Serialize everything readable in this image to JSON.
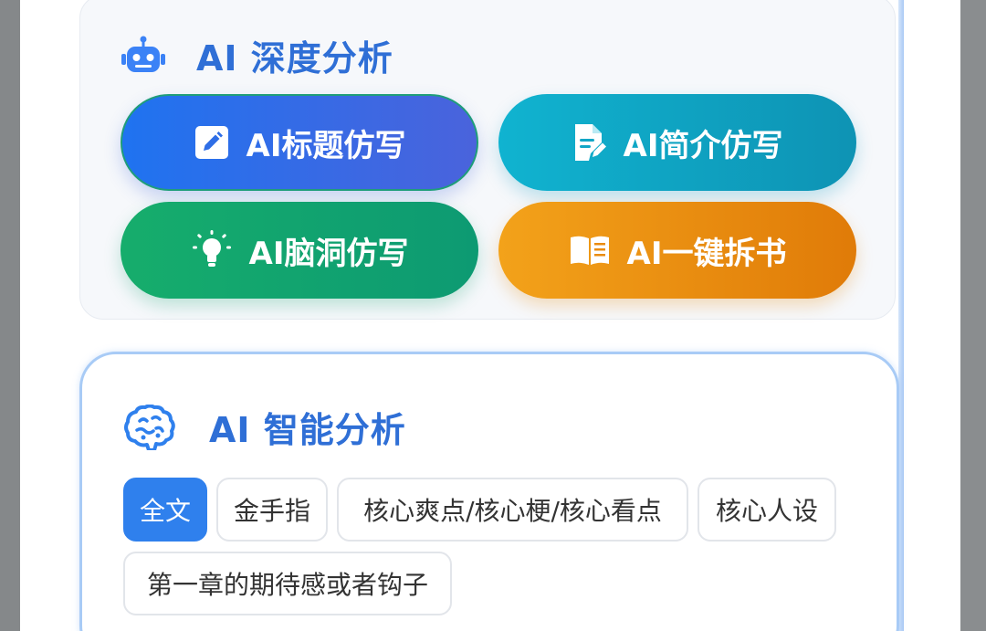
{
  "deep_analysis": {
    "title": "AI 深度分析",
    "icon": "robot-icon",
    "buttons": [
      {
        "label": "AI标题仿写",
        "icon": "edit-icon",
        "color": "#1f73f0"
      },
      {
        "label": "AI简介仿写",
        "icon": "document-edit-icon",
        "color": "#10b3d0"
      },
      {
        "label": "AI脑洞仿写",
        "icon": "lightbulb-icon",
        "color": "#16ad6c"
      },
      {
        "label": "AI一键拆书",
        "icon": "book-open-icon",
        "color": "#f3a21a"
      }
    ]
  },
  "smart_analysis": {
    "title": "AI 智能分析",
    "icon": "brain-icon",
    "tabs": [
      {
        "label": "全文",
        "active": true
      },
      {
        "label": "金手指",
        "active": false
      },
      {
        "label": "核心爽点/核心梗/核心看点",
        "active": false
      },
      {
        "label": "核心人设",
        "active": false
      },
      {
        "label": "第一章的期待感或者钩子",
        "active": false
      }
    ]
  },
  "colors": {
    "accent": "#2f80ed",
    "title": "#2f6fd6",
    "card_border": "#a8cbf6"
  }
}
